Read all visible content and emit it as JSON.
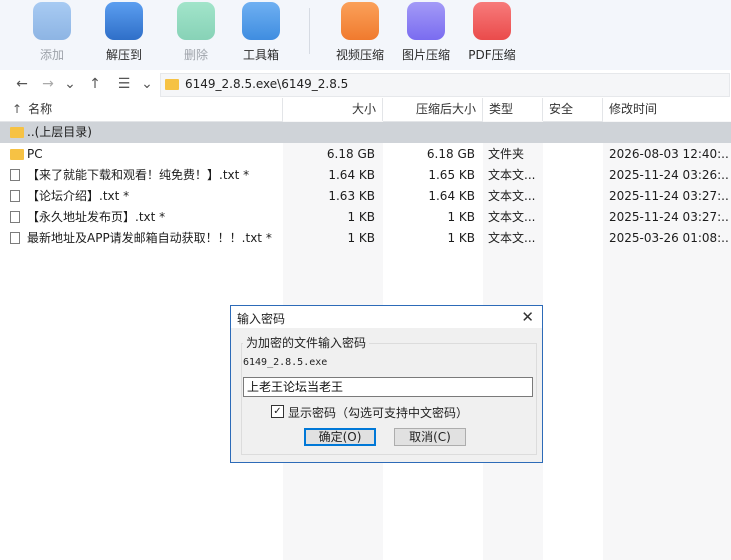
{
  "toolbar": {
    "items": [
      {
        "label": "添加",
        "icon": "add-archive-icon",
        "color": "#4a8fd8",
        "disabled": true
      },
      {
        "label": "解压到",
        "icon": "extract-icon",
        "color": "#3b7fd4",
        "disabled": false
      },
      {
        "label": "删除",
        "icon": "delete-icon",
        "color": "#2fb57f",
        "disabled": true
      },
      {
        "label": "工具箱",
        "icon": "toolbox-icon",
        "color": "#3f8de0",
        "disabled": false
      },
      {
        "label": "视频压缩",
        "icon": "video-compress-icon",
        "color": "#f07a2e",
        "disabled": false
      },
      {
        "label": "图片压缩",
        "icon": "image-compress-icon",
        "color": "#7a6cf0",
        "disabled": false
      },
      {
        "label": "PDF压缩",
        "icon": "pdf-compress-icon",
        "color": "#ea4b4b",
        "disabled": false
      }
    ]
  },
  "address": {
    "path": "6149_2.8.5.exe\\6149_2.8.5",
    "back_icon": "←",
    "forward_icon": "→",
    "history_icon": "⌄",
    "up_icon": "↑",
    "view_icon": "☰",
    "view_dropdown_icon": "⌄"
  },
  "columns": {
    "sort_arrow": "↑",
    "name": "名称",
    "size": "大小",
    "packed": "压缩后大小",
    "type": "类型",
    "security": "安全",
    "modified": "修改时间"
  },
  "rows": [
    {
      "name": "..(上层目录)",
      "size": "",
      "packed": "",
      "type": "",
      "modified": "",
      "kind": "folder"
    },
    {
      "name": "PC",
      "size": "6.18 GB",
      "packed": "6.18 GB",
      "type": "文件夹",
      "modified": "2026-08-03 12:40:...",
      "kind": "folder"
    },
    {
      "name": "【来了就能下载和观看！纯免费！】.txt *",
      "size": "1.64 KB",
      "packed": "1.65 KB",
      "type": "文本文...",
      "modified": "2025-11-24 03:26:...",
      "kind": "file"
    },
    {
      "name": "【论坛介绍】.txt *",
      "size": "1.63 KB",
      "packed": "1.64 KB",
      "type": "文本文...",
      "modified": "2025-11-24 03:27:...",
      "kind": "file"
    },
    {
      "name": "【永久地址发布页】.txt *",
      "size": "1 KB",
      "packed": "1 KB",
      "type": "文本文...",
      "modified": "2025-11-24 03:27:...",
      "kind": "file"
    },
    {
      "name": "最新地址及APP请发邮箱自动获取！！！.txt *",
      "size": "1 KB",
      "packed": "1 KB",
      "type": "文本文...",
      "modified": "2025-03-26 01:08:...",
      "kind": "file"
    }
  ],
  "dialog": {
    "title": "输入密码",
    "close_icon": "✕",
    "group_label": "为加密的文件输入密码",
    "filename": "6149_2.8.5.exe",
    "password_value": "上老王论坛当老王",
    "show_password_checked": "✓",
    "show_password_label": "显示密码（勾选可支持中文密码）",
    "ok_label": "确定(O)",
    "cancel_label": "取消(C)"
  }
}
